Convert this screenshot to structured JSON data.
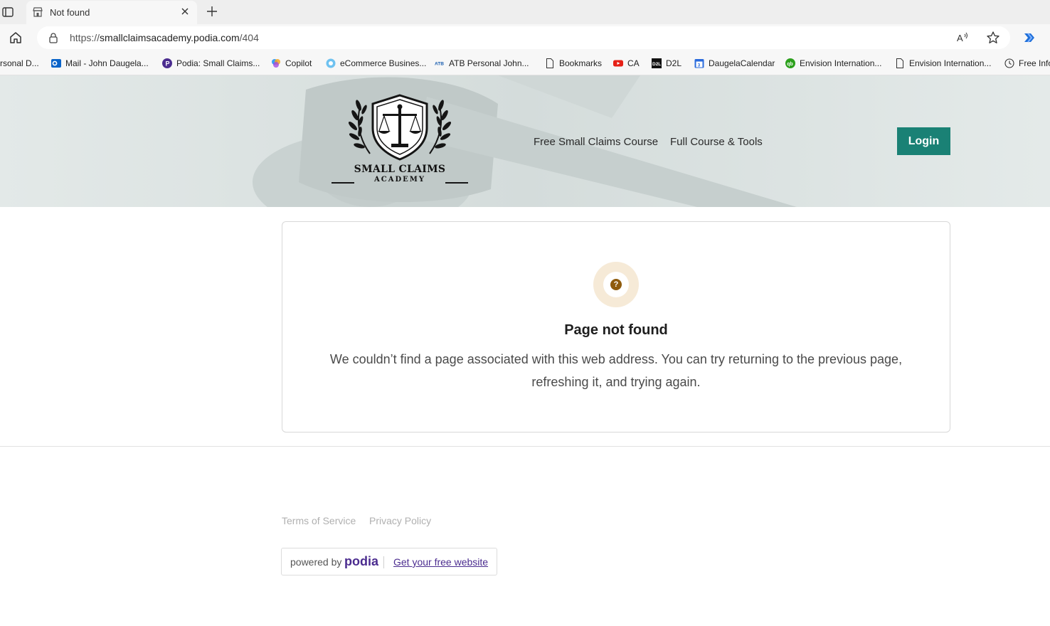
{
  "browser": {
    "tab_title": "Not found",
    "url_prefix": "https://",
    "url_host": "smallclaimsacademy.podia.com",
    "url_path": "/404",
    "bookmarks": [
      {
        "label": "rsonal D...",
        "icon": "partial-icon"
      },
      {
        "label": "Mail - John Daugela...",
        "icon": "outlook-icon"
      },
      {
        "label": "Podia: Small Claims...",
        "icon": "podia-icon"
      },
      {
        "label": "Copilot",
        "icon": "copilot-icon"
      },
      {
        "label": "eCommerce Busines...",
        "icon": "circle-icon"
      },
      {
        "label": "ATB Personal John...",
        "icon": "atb-icon"
      },
      {
        "label": "Bookmarks",
        "icon": "page-icon"
      },
      {
        "label": "CA",
        "icon": "youtube-icon"
      },
      {
        "label": "D2L",
        "icon": "d2l-icon"
      },
      {
        "label": "DaugelaCalendar",
        "icon": "calendar-icon"
      },
      {
        "label": "Envision Internation...",
        "icon": "quickbooks-icon"
      },
      {
        "label": "Envision Internation...",
        "icon": "page-icon"
      },
      {
        "label": "Free Info",
        "icon": "clock-icon"
      }
    ]
  },
  "header": {
    "logo_line1": "SMALL CLAIMS",
    "logo_line2": "ACADEMY",
    "nav": [
      "Free Small Claims Course",
      "Full Course & Tools"
    ],
    "login_label": "Login"
  },
  "error": {
    "icon_glyph": "?",
    "title": "Page not found",
    "message": "We couldn’t find a page associated with this web address. You can try returning to the previous page, refreshing it, and trying again."
  },
  "footer": {
    "terms": "Terms of Service",
    "privacy": "Privacy Policy",
    "powered_by": "powered by",
    "brand": "podia",
    "cta": "Get your free website"
  },
  "colors": {
    "accent": "#1a8175",
    "podia_purple": "#4b2c8f",
    "icon_brown": "#8f5b0c"
  }
}
